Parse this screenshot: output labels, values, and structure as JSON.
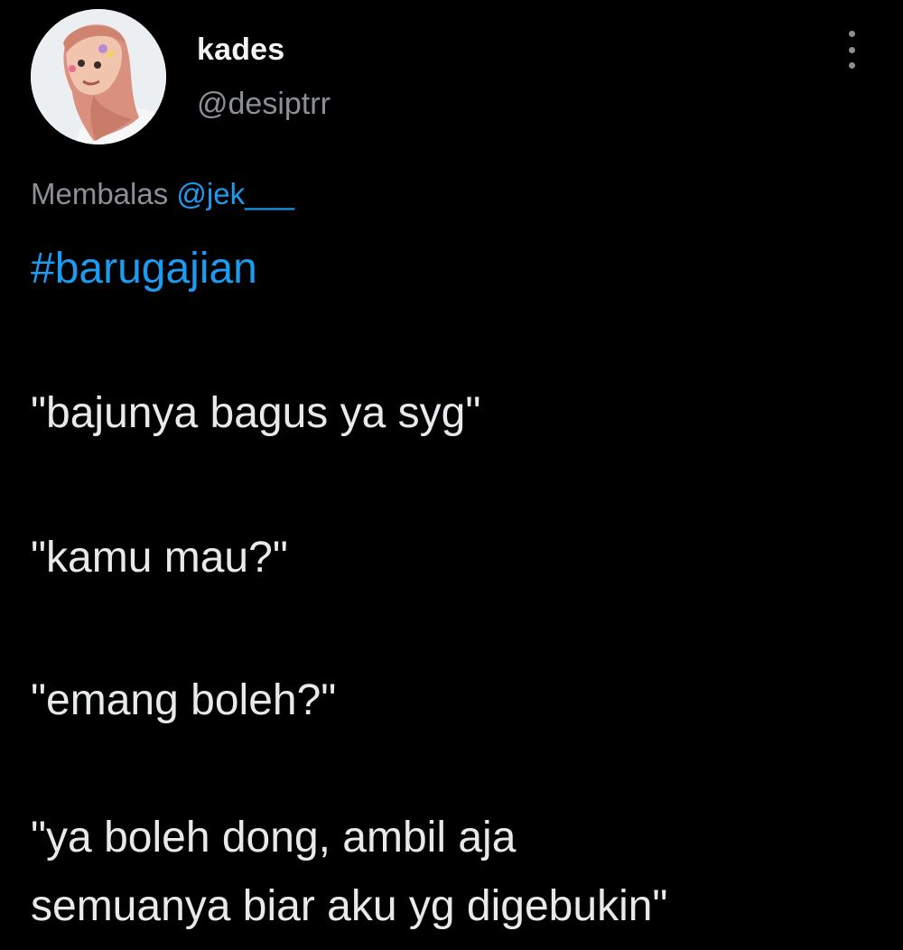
{
  "tweet": {
    "author": {
      "name": "kades",
      "handle": "@desiptrr",
      "avatar_icon": "profile-photo"
    },
    "menu_icon": "more-options-icon",
    "reply_to": {
      "prefix": "Membalas",
      "mention": "@jek___"
    },
    "hashtag": "#barugajian",
    "lines": [
      "\"bajunya bagus ya syg\"",
      "\"kamu mau?\"",
      "\"emang boleh?\"",
      "\"ya boleh dong, ambil aja",
      "semuanya biar aku yg digebukin\""
    ]
  },
  "colors": {
    "background": "#000000",
    "text": "#e7e9ea",
    "secondary": "#8b9096",
    "link": "#1d9bf0"
  }
}
